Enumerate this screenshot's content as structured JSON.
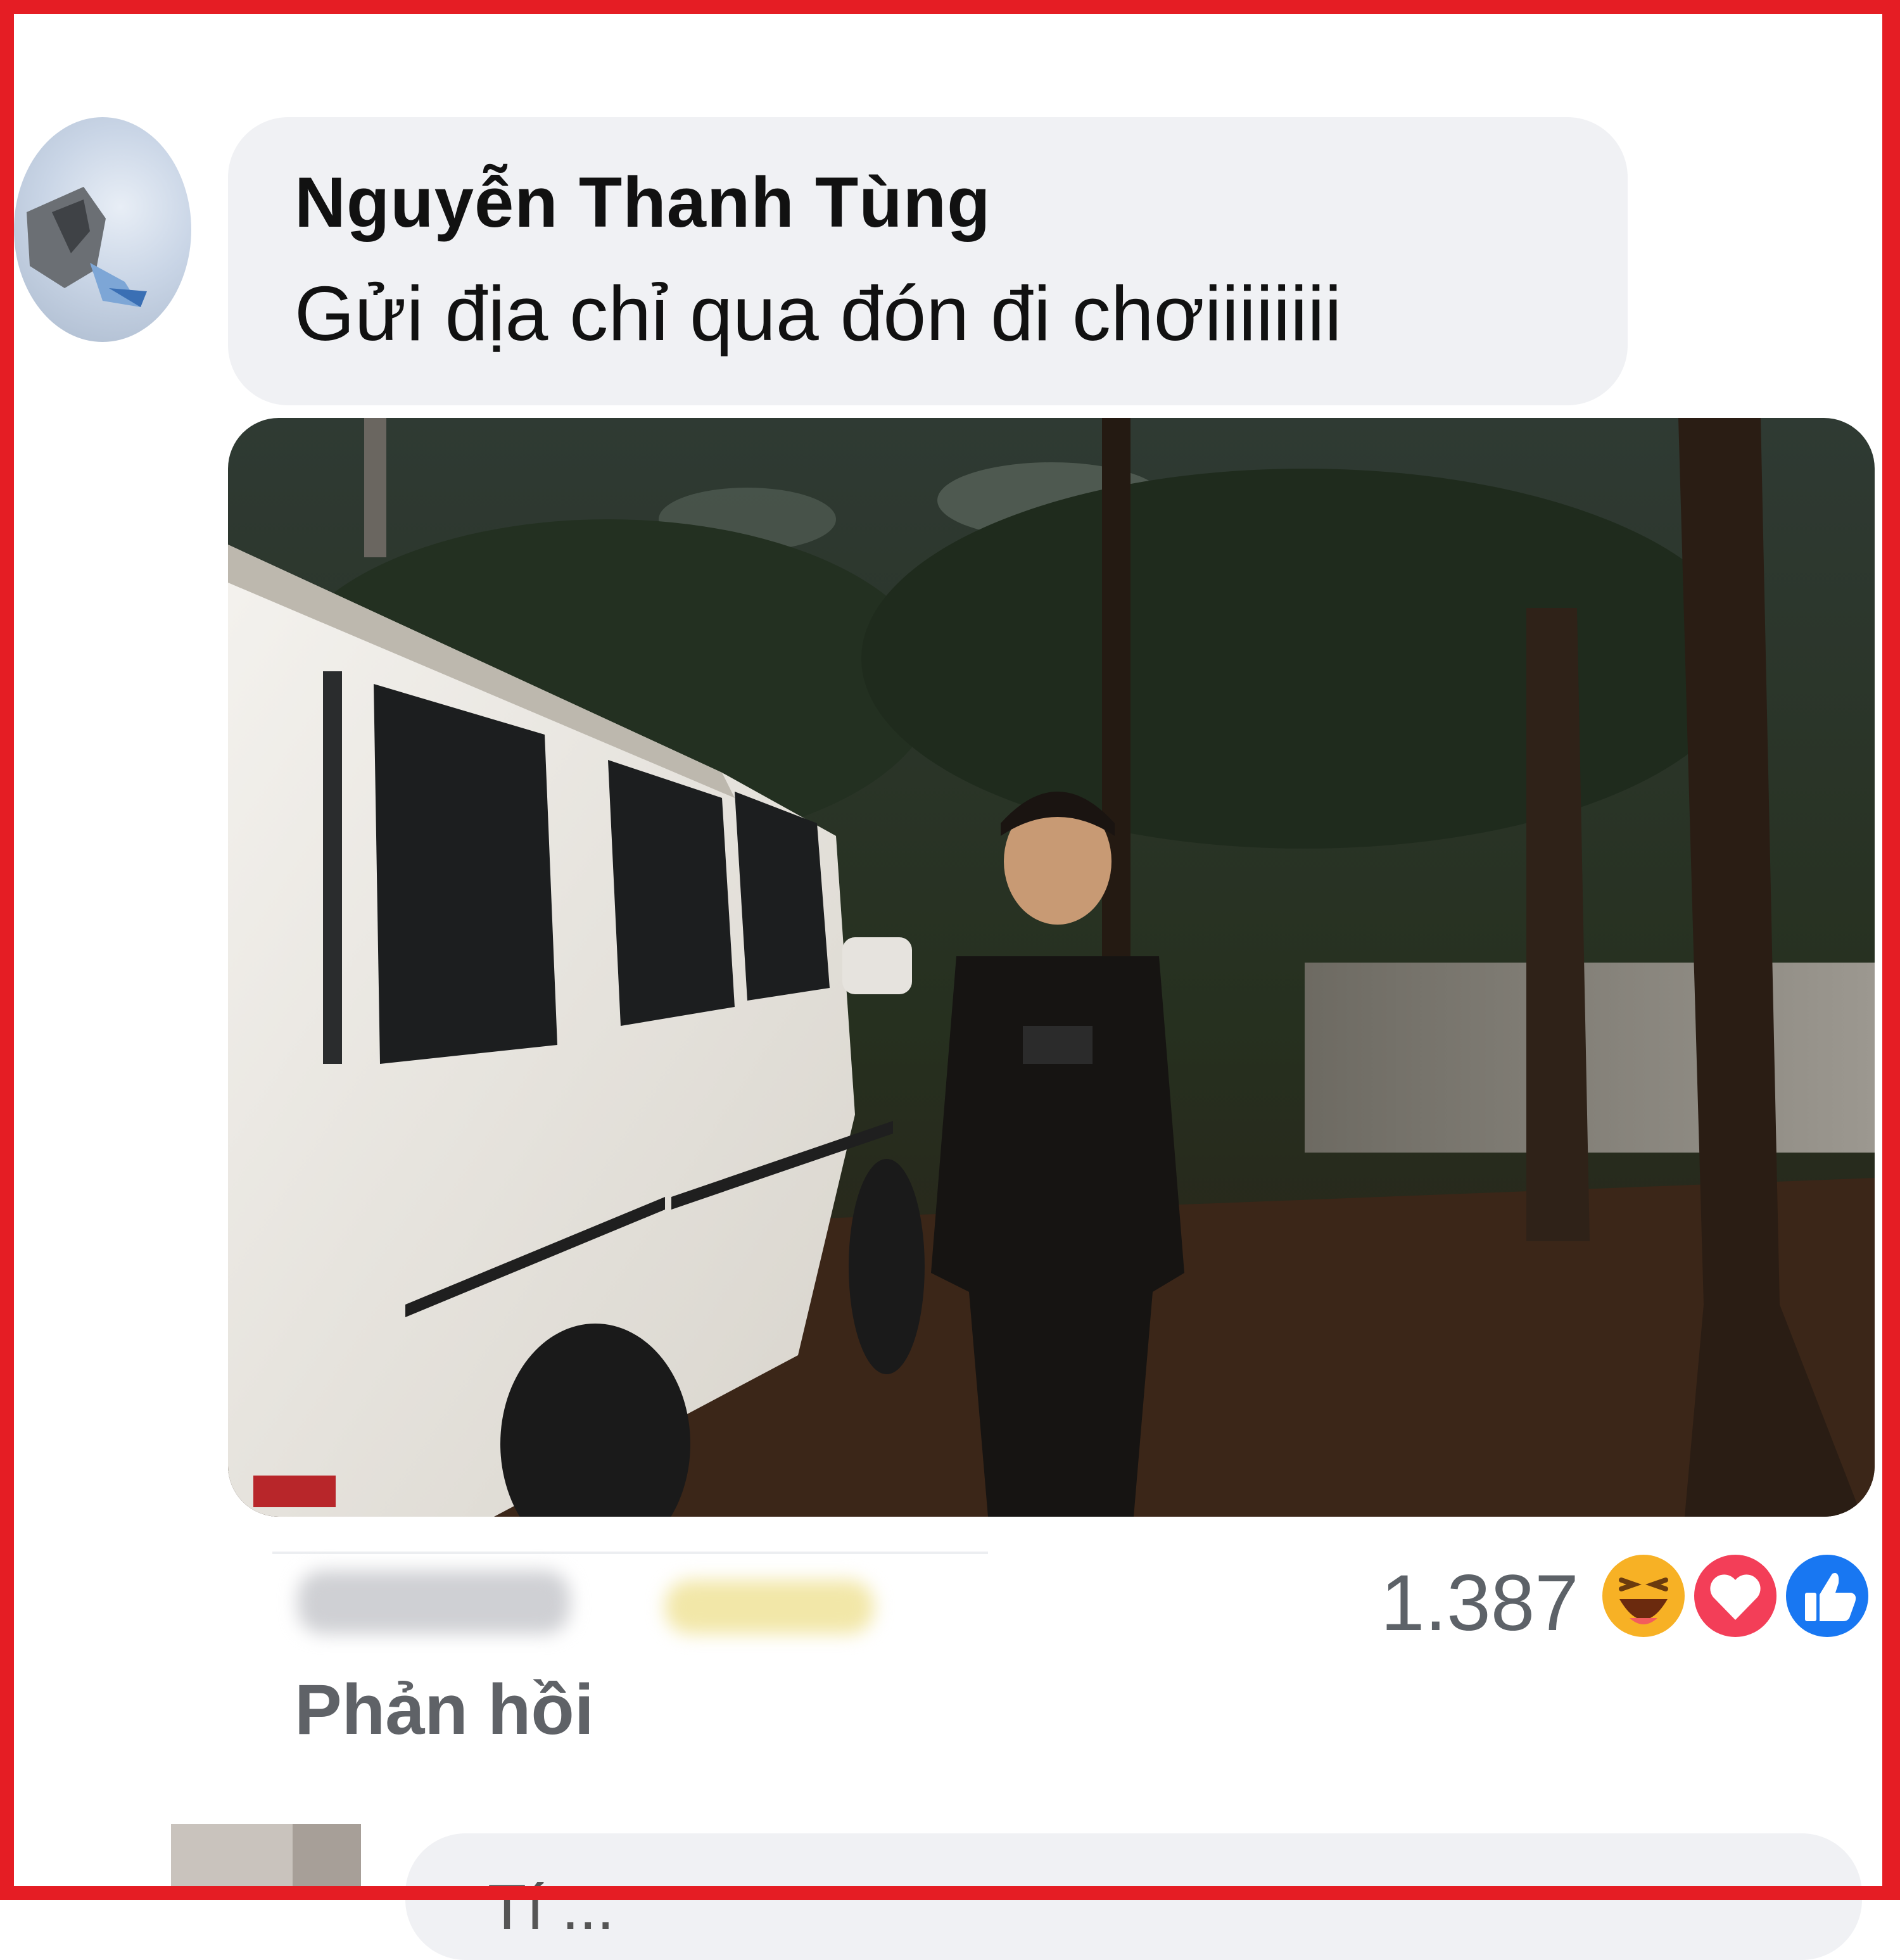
{
  "comment": {
    "author": "Nguyễn Thanh Tùng",
    "text": "Gửi địa chỉ qua đón đi chơiiiiiiii",
    "reaction_count": "1.387",
    "reactions": [
      "haha-icon",
      "love-icon",
      "like-icon"
    ],
    "reply_label": "Phản hồi"
  },
  "next_comment": {
    "text": "Tí ..."
  },
  "colors": {
    "frame_red": "#e51d24",
    "bubble_gray": "#f0f1f4",
    "like_blue": "#1877f2",
    "love_red": "#f33e58",
    "haha_yellow": "#f7b125"
  }
}
